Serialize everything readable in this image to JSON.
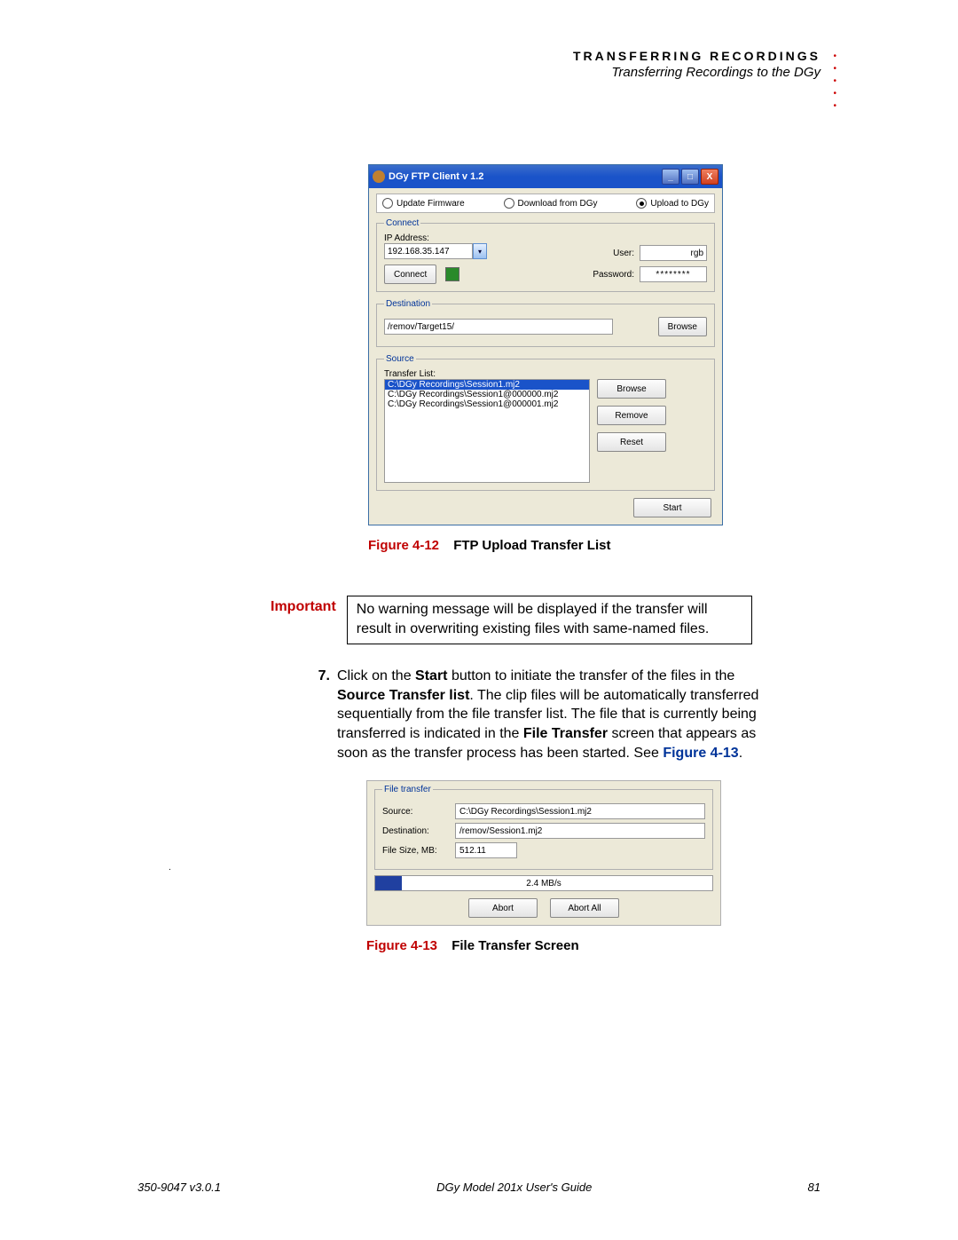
{
  "header": {
    "title": "TRANSFERRING RECORDINGS",
    "subtitle": "Transferring Recordings to the DGy"
  },
  "win": {
    "title": "DGy FTP Client v 1.2",
    "radios": {
      "update": "Update Firmware",
      "download": "Download from DGy",
      "upload": "Upload to DGy"
    },
    "connect": {
      "legend": "Connect",
      "ip_label": "IP Address:",
      "ip": "192.168.35.147",
      "connect_btn": "Connect",
      "user_label": "User:",
      "user": "rgb",
      "pwd_label": "Password:",
      "pwd": "********"
    },
    "dest": {
      "legend": "Destination",
      "path": "/remov/Target15/",
      "browse": "Browse"
    },
    "source": {
      "legend": "Source",
      "list_label": "Transfer List:",
      "items": [
        "C:\\DGy Recordings\\Session1.mj2",
        "C:\\DGy Recordings\\Session1@000000.mj2",
        "C:\\DGy Recordings\\Session1@000001.mj2"
      ],
      "browse": "Browse",
      "remove": "Remove",
      "reset": "Reset"
    },
    "start": "Start"
  },
  "fig12": {
    "num": "Figure 4-12",
    "title": "FTP Upload Transfer List"
  },
  "important": {
    "label": "Important",
    "text": "No warning message will be displayed if the transfer will result in overwriting existing files with same-named files."
  },
  "step7": {
    "num": "7.",
    "prefix": "Click on the ",
    "start": "Start",
    "mid1": " button to initiate the transfer of the files in the ",
    "list": "Source Transfer list",
    "mid2": ". The clip files will be automatically transferred sequentially from the file transfer list. The file that is currently being transferred is indicated in the ",
    "ft": "File Transfer",
    "mid3": " screen that appears as soon as the transfer process has been started. See ",
    "figref": "Figure 4-13",
    "end": "."
  },
  "ft": {
    "legend": "File transfer",
    "source_label": "Source:",
    "source": "C:\\DGy Recordings\\Session1.mj2",
    "dest_label": "Destination:",
    "dest": "/remov/Session1.mj2",
    "size_label": "File Size, MB:",
    "size": "512.11",
    "rate": "2.4 MB/s",
    "abort": "Abort",
    "abort_all": "Abort All"
  },
  "fig13": {
    "num": "Figure 4-13",
    "title": "File Transfer Screen"
  },
  "footer": {
    "left": "350-9047 v3.0.1",
    "center": "DGy Model 201x User's Guide",
    "right": "81"
  }
}
